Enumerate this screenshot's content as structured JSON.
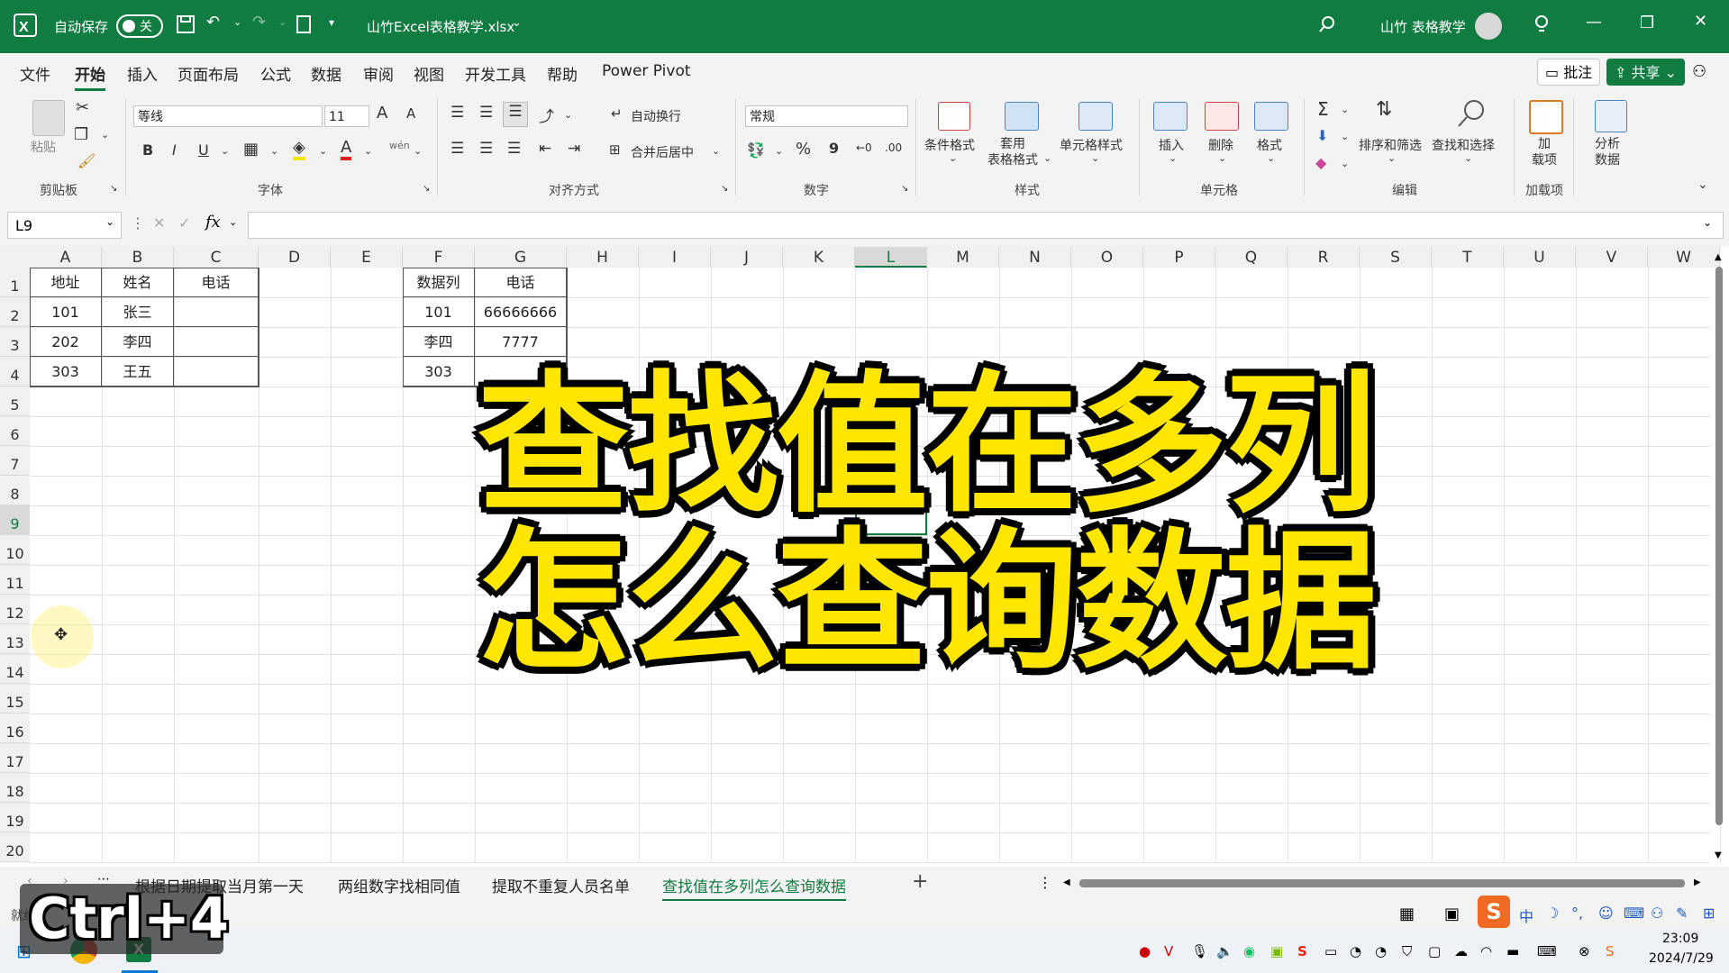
{
  "titlebar": {
    "autosave_label": "自动保存",
    "autosave_state": "关",
    "filename": "山竹Excel表格教学.xlsx",
    "user": "山竹 表格教学"
  },
  "menu": [
    "文件",
    "开始",
    "插入",
    "页面布局",
    "公式",
    "数据",
    "审阅",
    "视图",
    "开发工具",
    "帮助",
    "Power Pivot"
  ],
  "menu_active": "开始",
  "menu_right": {
    "comment": "批注",
    "share": "共享"
  },
  "ribbon": {
    "clipboard": {
      "paste": "粘贴",
      "group": "剪贴板"
    },
    "font": {
      "name": "等线",
      "size": "11",
      "bold": "B",
      "italic": "I",
      "underline": "U",
      "group": "字体",
      "grow": "A",
      "shrink": "A",
      "wen": "wén",
      "a_color": "A"
    },
    "align": {
      "wrap": "自动换行",
      "merge": "合并后居中",
      "group": "对齐方式"
    },
    "number": {
      "format": "常规",
      "percent": "%",
      "comma": "9",
      "group": "数字"
    },
    "styles": {
      "cond": "条件格式",
      "table": "套用\n表格格式",
      "cell": "单元格样式",
      "group": "样式"
    },
    "cells": {
      "insert": "插入",
      "delete": "删除",
      "format": "格式",
      "group": "单元格"
    },
    "edit": {
      "sort": "排序和筛选",
      "find": "查找和选择",
      "group": "编辑",
      "sum": "Σ"
    },
    "addin": {
      "addins": "加\n载项",
      "analyze": "分析\n数据",
      "group": "加载项"
    }
  },
  "formula": {
    "namebox": "L9",
    "fx": "fx",
    "value": ""
  },
  "columns": [
    "A",
    "B",
    "C",
    "D",
    "E",
    "F",
    "G",
    "H",
    "I",
    "J",
    "K",
    "L",
    "M",
    "N",
    "O",
    "P",
    "Q",
    "R",
    "S",
    "T",
    "U",
    "V",
    "W"
  ],
  "rows": [
    "1",
    "2",
    "3",
    "4",
    "5",
    "6",
    "7",
    "8",
    "9",
    "10",
    "11",
    "12",
    "13",
    "14",
    "15",
    "16",
    "17",
    "18",
    "19",
    "20"
  ],
  "table1": {
    "headers": [
      "地址",
      "姓名",
      "电话"
    ],
    "rows": [
      [
        "101",
        "张三",
        ""
      ],
      [
        "202",
        "李四",
        ""
      ],
      [
        "303",
        "王五",
        ""
      ]
    ]
  },
  "table2": {
    "headers": [
      "数据列",
      "电话"
    ],
    "rows": [
      [
        "101",
        "66666666"
      ],
      [
        "李四",
        "7777"
      ],
      [
        "303",
        ""
      ]
    ]
  },
  "overlay": {
    "line1": "查找值在多列",
    "line2": "怎么查询数据"
  },
  "sheets": [
    "根据日期提取当月第一天",
    "两组数字找相同值",
    "提取不重复人员名单",
    "查找值在多列怎么查询数据"
  ],
  "sheet_active": "查找值在多列怎么查询数据",
  "status": {
    "ready": "就绪",
    "shortcut": "Ctrl+4"
  },
  "taskbar": {
    "time": "23:09",
    "date": "2024/7/29",
    "ime": "中"
  },
  "colors": {
    "excel_green": "#107c41",
    "highlight": "#ffe600"
  }
}
